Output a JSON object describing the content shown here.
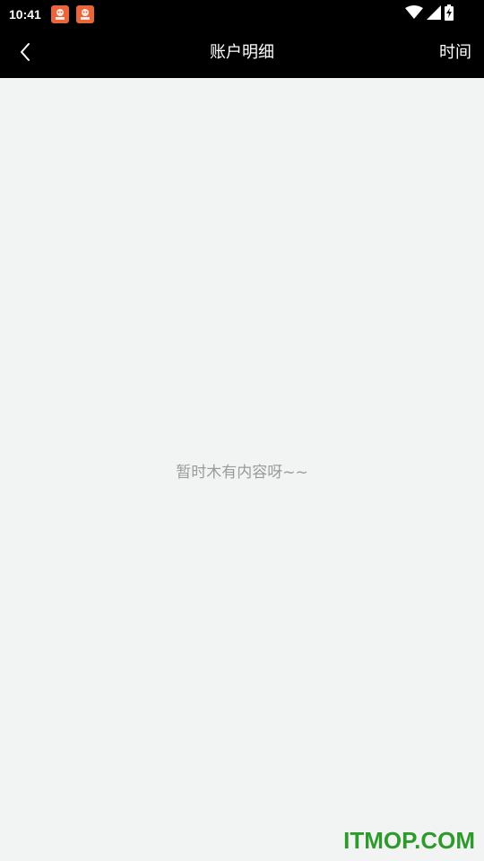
{
  "status_bar": {
    "time": "10:41",
    "notifications": [
      "app-notification-icon",
      "app-notification-icon"
    ],
    "icons": [
      "wifi-icon",
      "cellular-signal-icon",
      "battery-charging-icon"
    ]
  },
  "nav_bar": {
    "title": "账户明细",
    "right_action": "时间",
    "back_icon": "chevron-left-icon"
  },
  "content": {
    "empty_message": "暂时木有内容呀~~"
  },
  "watermark": {
    "text": "ITMOP.COM"
  },
  "colors": {
    "bar_background": "#000000",
    "page_background": "#f2f4f3",
    "empty_text": "#9a9a9a",
    "watermark": "#2f9a2c",
    "notification_icon": "#e9653b"
  }
}
